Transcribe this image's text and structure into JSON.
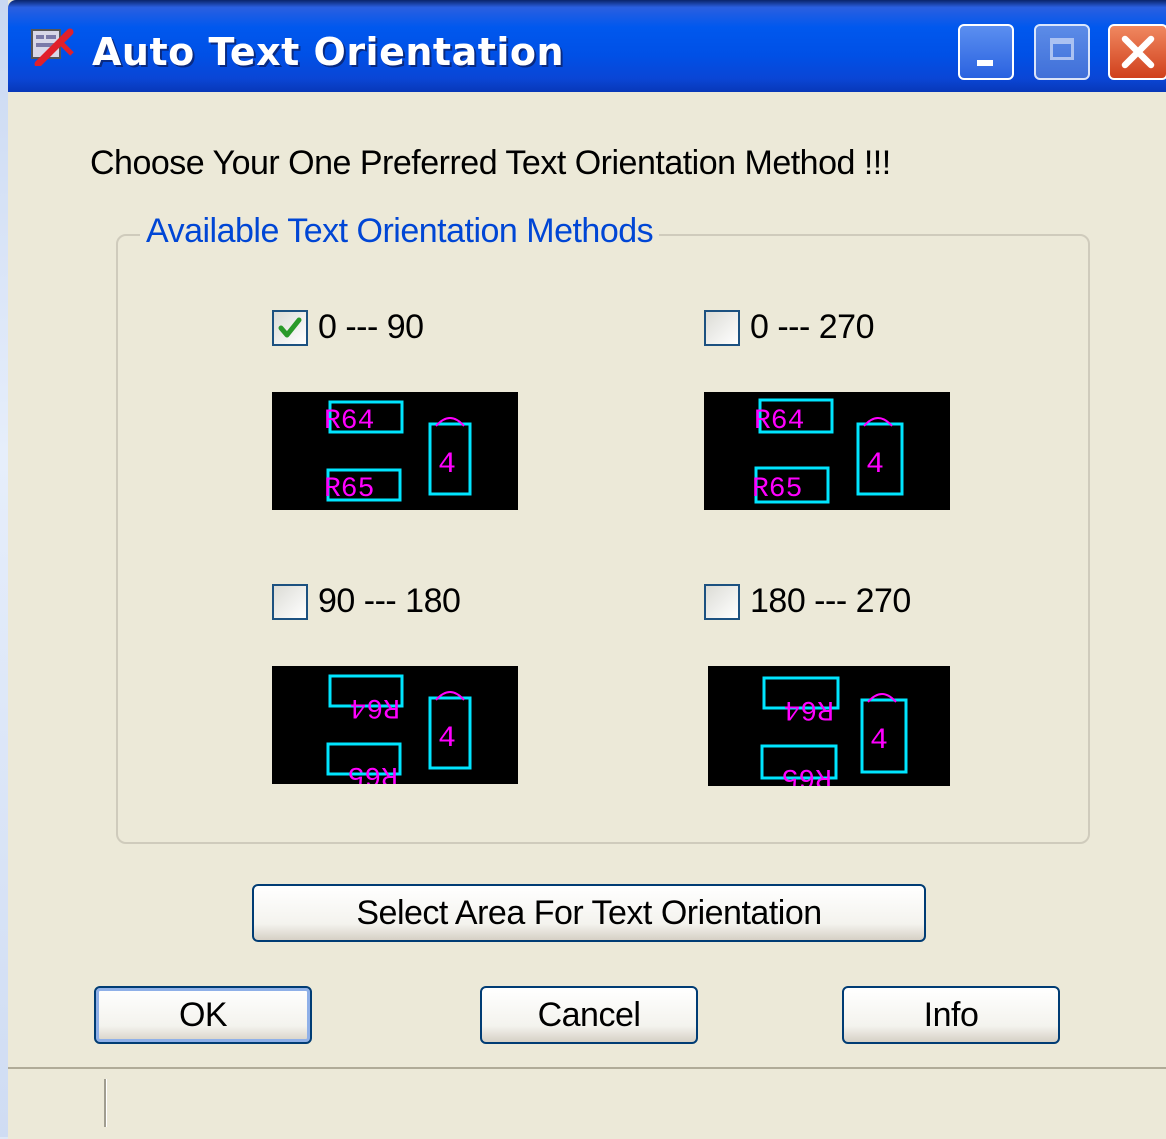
{
  "window": {
    "title": "Auto Text Orientation",
    "app_icon": "app-icon"
  },
  "titlebar_buttons": {
    "minimize": "minimize-icon",
    "maximize": "maximize-icon",
    "close": "close-icon"
  },
  "prompt": "Choose Your One Preferred Text Orientation Method !!!",
  "group": {
    "legend": "Available Text Orientation Methods",
    "options": [
      {
        "label": "0 --- 90",
        "checked": true
      },
      {
        "label": "0 --- 270",
        "checked": false
      },
      {
        "label": "90 --- 180",
        "checked": false
      },
      {
        "label": "180 --- 270",
        "checked": false
      }
    ]
  },
  "previews": {
    "top_label": "R64",
    "bottom_label": "R65",
    "top_label_flipped": "R64",
    "bottom_label_flipped": "R65",
    "pin_label": "4"
  },
  "buttons": {
    "select_area": "Select Area For Text Orientation",
    "ok": "OK",
    "cancel": "Cancel",
    "info": "Info"
  },
  "colors": {
    "titlebar": "#0058ee",
    "legend_text": "#0046d5",
    "check": "#2a9a2a",
    "preview_bg": "#000000",
    "preview_magenta": "#ff00ff",
    "preview_cyan": "#00e5ff"
  }
}
